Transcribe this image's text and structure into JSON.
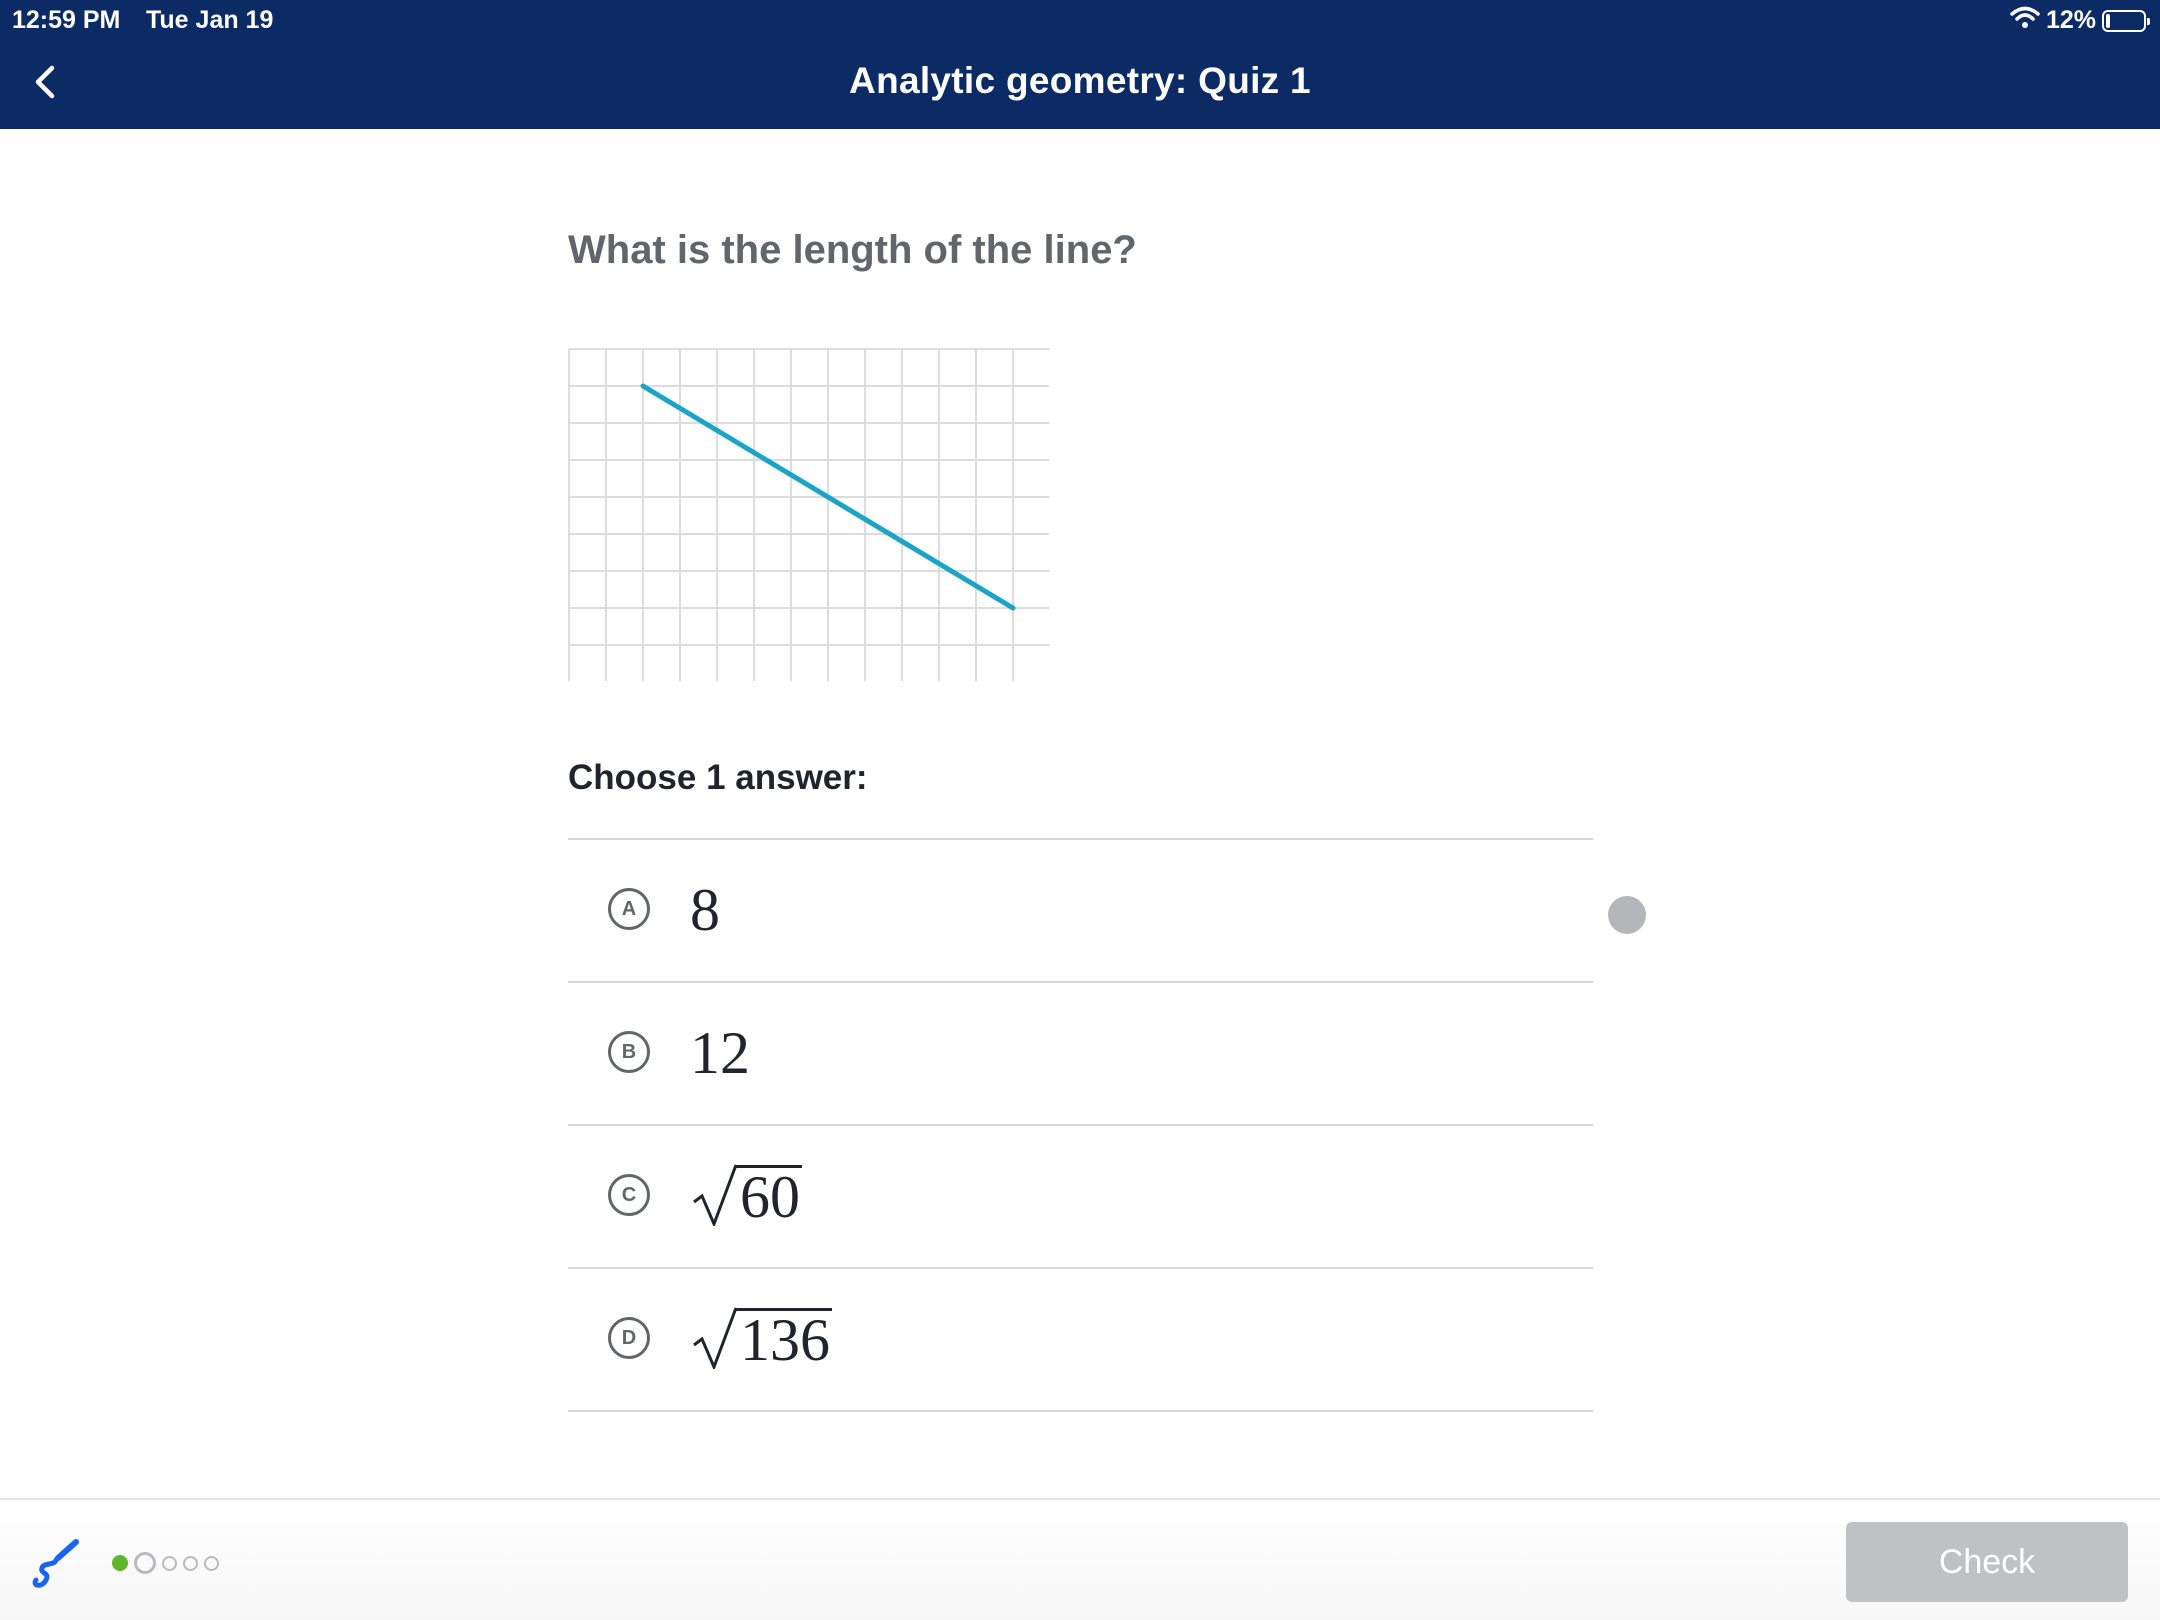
{
  "status_bar": {
    "time": "12:59 PM",
    "date": "Tue Jan 19",
    "battery_percent": "12%",
    "battery_level": 0.12,
    "icons": [
      "wifi-icon",
      "battery-icon"
    ]
  },
  "nav": {
    "back_icon": "chevron-left-icon",
    "title": "Analytic geometry: Quiz 1"
  },
  "question": {
    "prompt": "What is the length of the line?",
    "grid": {
      "columns": 13,
      "rows": 9,
      "line_start": [
        2,
        1
      ],
      "line_end": [
        12,
        7
      ],
      "line_color": "#1aa5c8"
    }
  },
  "answers": {
    "instruction": "Choose 1 answer:",
    "choices": [
      {
        "letter": "A",
        "value": "8",
        "radical": false
      },
      {
        "letter": "B",
        "value": "12",
        "radical": false
      },
      {
        "letter": "C",
        "value": "60",
        "radical": true
      },
      {
        "letter": "D",
        "value": "136",
        "radical": true
      }
    ]
  },
  "footer": {
    "scratchpad_icon": "scratchpad-pencil-icon",
    "progress": {
      "completed": 1,
      "current": 2,
      "total": 5
    },
    "check_label": "Check"
  },
  "colors": {
    "header_bg": "#0c2a63",
    "accent_line": "#1aa5c8",
    "progress_done": "#5cb82a",
    "button_disabled": "#bfc1c4"
  }
}
